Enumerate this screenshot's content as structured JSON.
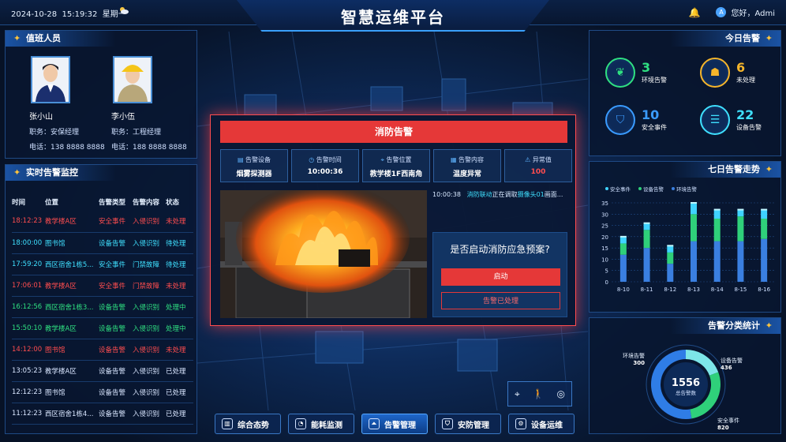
{
  "header": {
    "date": "2024-10-28",
    "time": "15:19:32",
    "weekday": "星期一",
    "title": "智慧运维平台",
    "greeting": "您好，Admi",
    "avatar_letter": "A"
  },
  "duty": {
    "title": "值班人员",
    "staff": [
      {
        "name": "张小山",
        "role": "职务：安保经理",
        "phone": "电话：138 8888 8888"
      },
      {
        "name": "李小伍",
        "role": "职务：工程经理",
        "phone": "电话：188 8888 8888"
      }
    ]
  },
  "alarm_monitor": {
    "title": "实时告警监控",
    "columns": [
      "时间",
      "位置",
      "告警类型",
      "告警内容",
      "状态"
    ],
    "rows": [
      {
        "time": "18:12:23",
        "loc": "教学楼A区",
        "type": "安全事件",
        "content": "入侵识别",
        "status": "未处理",
        "color": "red"
      },
      {
        "time": "18:00:00",
        "loc": "图书馆",
        "type": "设备告警",
        "content": "入侵识别",
        "status": "待处理",
        "color": "cyan"
      },
      {
        "time": "17:59:20",
        "loc": "西区宿舍1栋5...",
        "type": "安全事件",
        "content": "门禁故障",
        "status": "待处理",
        "color": "cyan"
      },
      {
        "time": "17:06:01",
        "loc": "教学楼A区",
        "type": "安全事件",
        "content": "门禁故障",
        "status": "未处理",
        "color": "red"
      },
      {
        "time": "16:12:56",
        "loc": "西区宿舍1栋3...",
        "type": "设备告警",
        "content": "入侵识别",
        "status": "处理中",
        "color": "green"
      },
      {
        "time": "15:50:10",
        "loc": "教学楼A区",
        "type": "设备告警",
        "content": "入侵识别",
        "status": "处理中",
        "color": "green"
      },
      {
        "time": "14:12:00",
        "loc": "图书馆",
        "type": "设备告警",
        "content": "入侵识别",
        "status": "未处理",
        "color": "red"
      },
      {
        "time": "13:05:23",
        "loc": "教学楼A区",
        "type": "设备告警",
        "content": "入侵识别",
        "status": "已处理",
        "color": "white"
      },
      {
        "time": "12:12:23",
        "loc": "图书馆",
        "type": "设备告警",
        "content": "入侵识别",
        "status": "已处理",
        "color": "white"
      },
      {
        "time": "11:12:23",
        "loc": "西区宿舍1栋4...",
        "type": "设备告警",
        "content": "入侵识别",
        "status": "已处理",
        "color": "white"
      }
    ]
  },
  "modal": {
    "title": "消防告警",
    "info": [
      {
        "label": "告警设备",
        "value": "烟雾探测器",
        "icon": "device-icon"
      },
      {
        "label": "告警时间",
        "value": "10:00:36",
        "icon": "clock-icon"
      },
      {
        "label": "告警位置",
        "value": "教学楼1F西南角",
        "icon": "location-icon"
      },
      {
        "label": "告警内容",
        "value": "温度异常",
        "icon": "grid-icon"
      },
      {
        "label": "异常值",
        "value": "100",
        "icon": "warning-icon"
      }
    ],
    "log_time": "10:00:38",
    "log_tag": "消防联动",
    "log_text_a": "正在调取",
    "log_camera": "摄像头01",
    "log_text_b": "画面...",
    "question": "是否启动消防应急预案?",
    "start_label": "启动",
    "handled_label": "告警已处理"
  },
  "today": {
    "title": "今日告警",
    "items": [
      {
        "value": "3",
        "label": "环境告警",
        "color": "#2fe081"
      },
      {
        "value": "6",
        "label": "未处理",
        "color": "#f5b52b"
      },
      {
        "value": "10",
        "label": "安全事件",
        "color": "#3a9bff"
      },
      {
        "value": "22",
        "label": "设备告警",
        "color": "#3fe0ff"
      }
    ]
  },
  "chart_data": {
    "type": "bar",
    "title": "七日告警走势",
    "categories": [
      "8-10",
      "8-11",
      "8-12",
      "8-13",
      "8-14",
      "8-15",
      "8-16"
    ],
    "ylim": [
      0,
      35
    ],
    "yticks": [
      0,
      5,
      10,
      15,
      20,
      25,
      30,
      35
    ],
    "series": [
      {
        "name": "安全事件",
        "color": "#3fd3ff",
        "values": [
          3,
          3,
          3,
          5,
          4,
          3,
          4
        ]
      },
      {
        "name": "设备告警",
        "color": "#2fd07a",
        "values": [
          5,
          8,
          5,
          12,
          10,
          11,
          9
        ]
      },
      {
        "name": "环境告警",
        "color": "#3a7fe0",
        "values": [
          12,
          15,
          8,
          18,
          18,
          18,
          19
        ]
      }
    ],
    "stacked": true,
    "legend": "top-left"
  },
  "category_stats": {
    "title": "告警分类统计",
    "total": "1556",
    "total_label": "总告警数",
    "slices": [
      {
        "name": "环境告警",
        "value": 300,
        "color": "#7de6e8"
      },
      {
        "name": "设备告警",
        "value": 436,
        "color": "#2fd07a"
      },
      {
        "name": "安全事件",
        "value": 820,
        "color": "#2f7de6"
      }
    ]
  },
  "nav": [
    {
      "label": "综合态势",
      "icon": "dashboard-icon"
    },
    {
      "label": "能耗监测",
      "icon": "gauge-icon"
    },
    {
      "label": "告警管理",
      "icon": "alarm-icon"
    },
    {
      "label": "安防管理",
      "icon": "shield-icon"
    },
    {
      "label": "设备运维",
      "icon": "wrench-icon"
    }
  ]
}
